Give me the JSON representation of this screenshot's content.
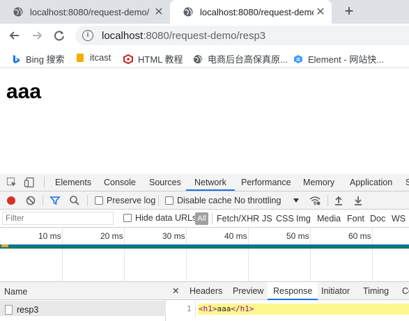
{
  "browser": {
    "tabs": [
      {
        "title": "localhost:8080/request-demo/",
        "close": "✕"
      },
      {
        "title": "localhost:8080/request-demo/",
        "close": "✕"
      }
    ],
    "new_tab": "+",
    "address": {
      "host": "localhost",
      "rest": ":8080/request-demo/resp3"
    },
    "bookmarks": [
      {
        "label": "Bing 搜索",
        "icon": "bing-icon"
      },
      {
        "label": "itcast",
        "icon": "folder-icon"
      },
      {
        "label": "HTML 教程",
        "icon": "html-icon"
      },
      {
        "label": "电商后台高保真原...",
        "icon": "globe-icon"
      },
      {
        "label": "Element - 网站快...",
        "icon": "element-icon"
      }
    ]
  },
  "page": {
    "heading": "aaa"
  },
  "devtools": {
    "tabs": [
      "Elements",
      "Console",
      "Sources",
      "Network",
      "Performance",
      "Memory",
      "Application",
      "S"
    ],
    "active_tab": "Network",
    "toolbar": {
      "preserve_log": "Preserve log",
      "disable_cache": "Disable cache",
      "throttling": "No throttling"
    },
    "filter": {
      "placeholder": "Filter",
      "hide_data_urls": "Hide data URLs",
      "types": [
        "All",
        "Fetch/XHR",
        "JS",
        "CSS",
        "Img",
        "Media",
        "Font",
        "Doc",
        "WS"
      ]
    },
    "timeline": {
      "ticks": [
        "10 ms",
        "20 ms",
        "30 ms",
        "40 ms",
        "50 ms",
        "60 ms"
      ]
    },
    "requests": {
      "header": "Name",
      "rows": [
        "resp3"
      ]
    },
    "detail": {
      "close": "✕",
      "tabs": [
        "Headers",
        "Preview",
        "Response",
        "Initiator",
        "Timing",
        "Co"
      ],
      "active_tab": "Response",
      "line_number": "1",
      "code": {
        "open": "<h1>",
        "text": "aaa",
        "close": "</h1>"
      }
    }
  },
  "colors": {
    "accent": "#1a73e8",
    "record": "#d93025",
    "highlight": "#fff68f",
    "waterfall": "#0f7a6b"
  }
}
